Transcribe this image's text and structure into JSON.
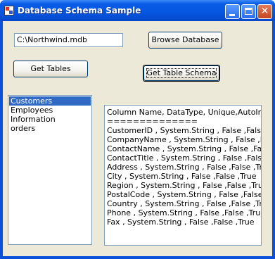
{
  "window": {
    "title": "Database Schema Sample"
  },
  "path_field": {
    "value": "C:\\Northwind.mdb"
  },
  "buttons": {
    "browse": "Browse Database",
    "get_tables": "Get Tables",
    "get_schema": "Get Table Schema"
  },
  "tables_list": {
    "items": [
      "Customers",
      "Employees",
      "Information",
      "orders"
    ],
    "selected": "Customers"
  },
  "schema_output": {
    "lines": [
      "Column Name, DataType, Unique,AutoIncrement",
      "==============",
      "CustomerID , System.String , False ,False ,True",
      "CompanyName , System.String , False ,False ,True",
      "ContactName , System.String , False ,False ,True",
      "ContactTitle , System.String , False ,False ,True",
      "Address , System.String , False ,False ,True",
      "City , System.String , False ,False ,True",
      "Region , System.String , False ,False ,True",
      "PostalCode , System.String , False ,False ,True",
      "Country , System.String , False ,False ,True",
      "Phone , System.String , False ,False ,True",
      "Fax , System.String , False ,False ,True"
    ]
  },
  "colors": {
    "titlebar": "#0556e0",
    "client_bg": "#ece9d8",
    "selection": "#316ac5"
  }
}
